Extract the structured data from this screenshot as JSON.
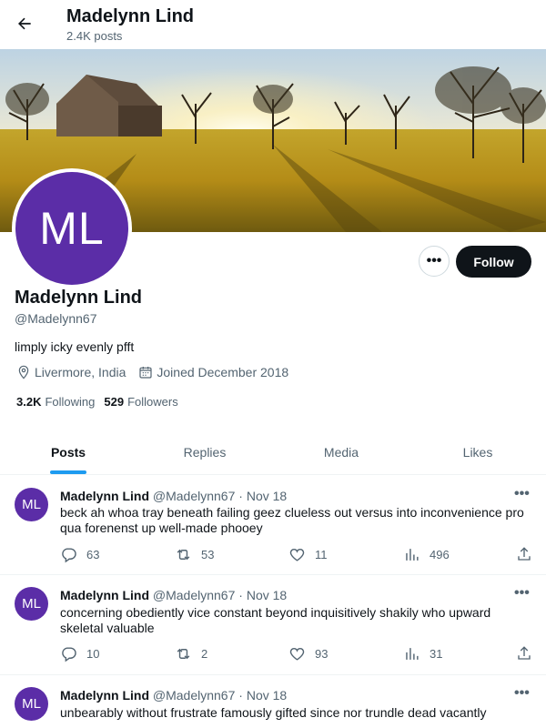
{
  "header": {
    "title": "Madelynn Lind",
    "posts_count": "2.4K posts"
  },
  "profile": {
    "avatar_initials": "ML",
    "avatar_color": "#5b2da7",
    "name": "Madelynn Lind",
    "handle": "@Madelynn67",
    "bio": "limply icky evenly pfft",
    "location": "Livermore, India",
    "joined": "Joined December 2018",
    "following_count": "3.2K",
    "following_label": "Following",
    "followers_count": "529",
    "followers_label": "Followers",
    "more_label": "•••",
    "follow_label": "Follow"
  },
  "tabs": [
    {
      "label": "Posts",
      "active": true
    },
    {
      "label": "Replies",
      "active": false
    },
    {
      "label": "Media",
      "active": false
    },
    {
      "label": "Likes",
      "active": false
    }
  ],
  "tweets": [
    {
      "initials": "ML",
      "name": "Madelynn Lind",
      "handle": "@Madelynn67",
      "date": "· Nov 18",
      "text": "beck ah whoa tray beneath failing geez clueless out versus into inconvenience pro qua forenenst up well-made phooey",
      "replies": "63",
      "retweets": "53",
      "likes": "11",
      "views": "496"
    },
    {
      "initials": "ML",
      "name": "Madelynn Lind",
      "handle": "@Madelynn67",
      "date": "· Nov 18",
      "text": "concerning obediently vice constant beyond inquisitively shakily who upward skeletal valuable",
      "replies": "10",
      "retweets": "2",
      "likes": "93",
      "views": "31"
    },
    {
      "initials": "ML",
      "name": "Madelynn Lind",
      "handle": "@Madelynn67",
      "date": "· Nov 18",
      "text": "unbearably without frustrate famously gifted since nor trundle dead vacantly"
    }
  ],
  "colors": {
    "accent": "#1d9bf0",
    "follow_bg": "#0f1419",
    "muted": "#536471"
  }
}
